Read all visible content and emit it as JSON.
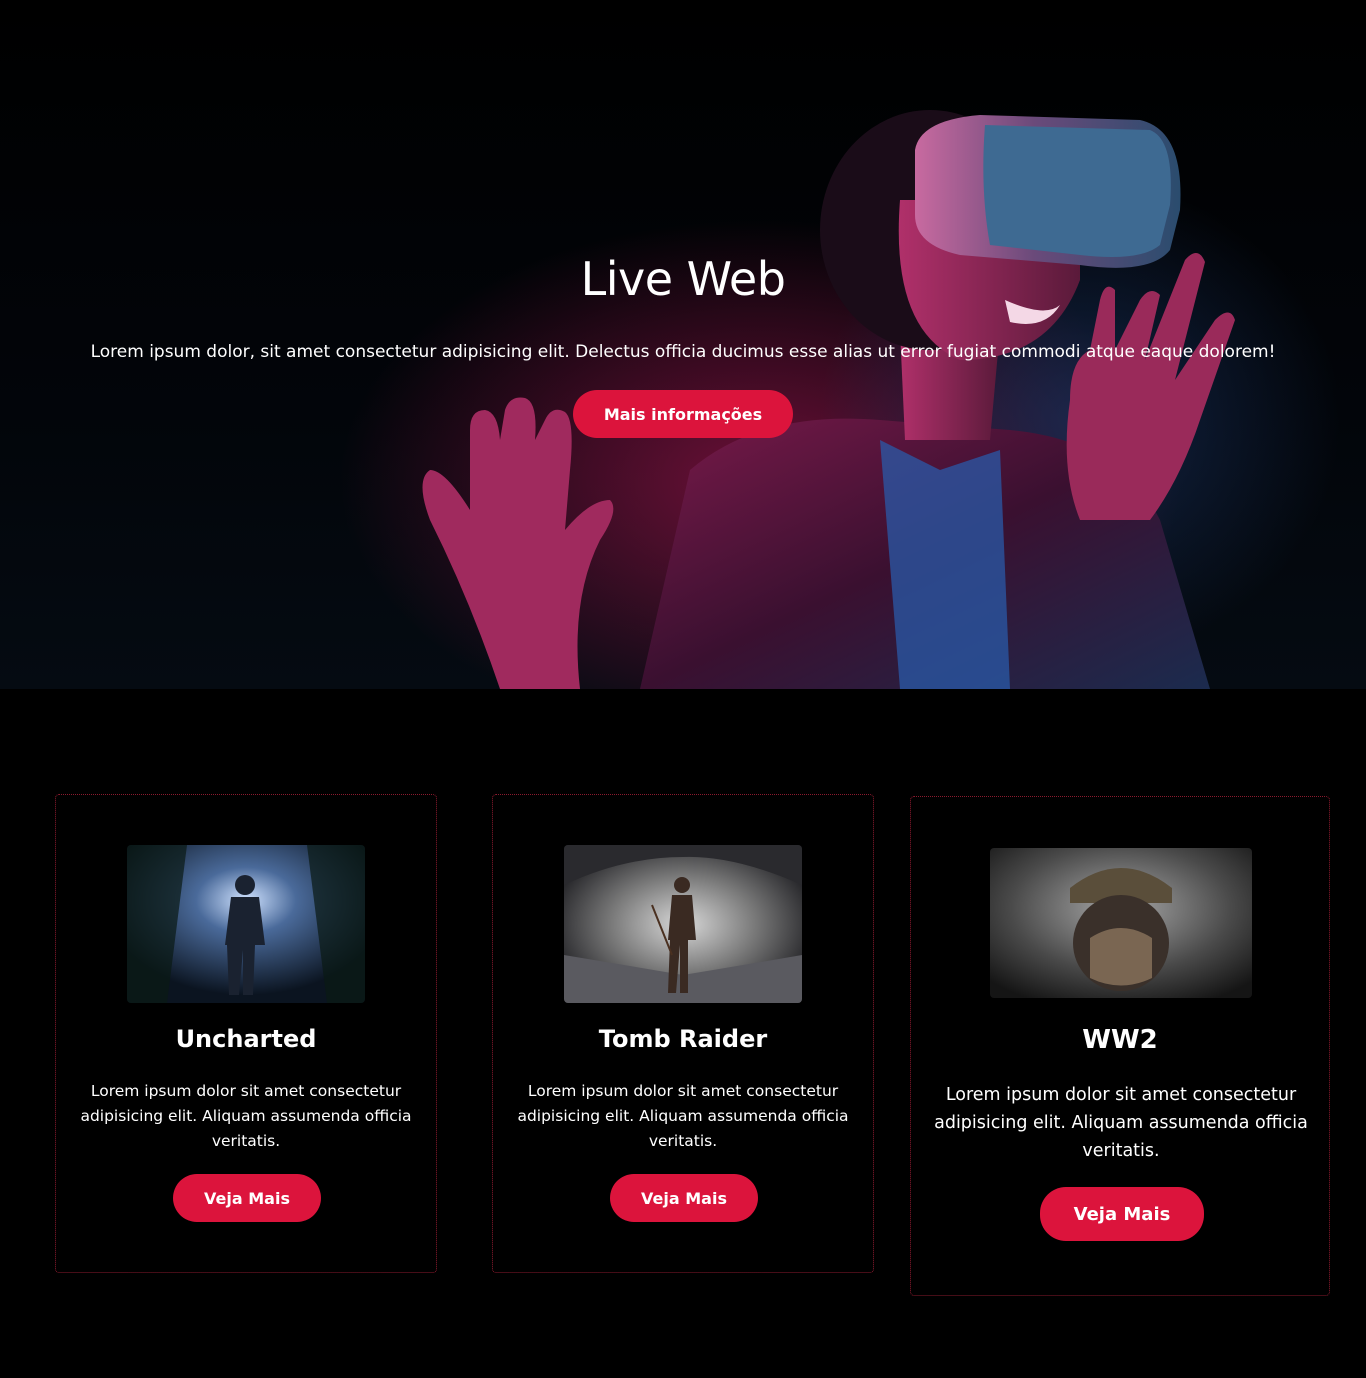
{
  "hero": {
    "title": "Live Web",
    "text": "Lorem ipsum dolor, sit amet consectetur adipisicing elit. Delectus officia ducimus esse alias ut error fugiat commodi atque eaque dolorem!",
    "button_label": "Mais informações"
  },
  "cards": [
    {
      "title": "Uncharted",
      "text": "Lorem ipsum dolor sit amet consectetur adipisicing elit. Aliquam assumenda officia veritatis.",
      "button_label": "Veja Mais"
    },
    {
      "title": "Tomb Raider",
      "text": "Lorem ipsum dolor sit amet consectetur adipisicing elit. Aliquam assumenda officia veritatis.",
      "button_label": "Veja Mais"
    },
    {
      "title": "WW2",
      "text": "Lorem ipsum dolor sit amet consectetur adipisicing elit. Aliquam assumenda officia veritatis.",
      "button_label": "Veja Mais"
    }
  ],
  "colors": {
    "accent": "#dc143c",
    "background": "#000000",
    "card_border": "#8b1a2e"
  }
}
